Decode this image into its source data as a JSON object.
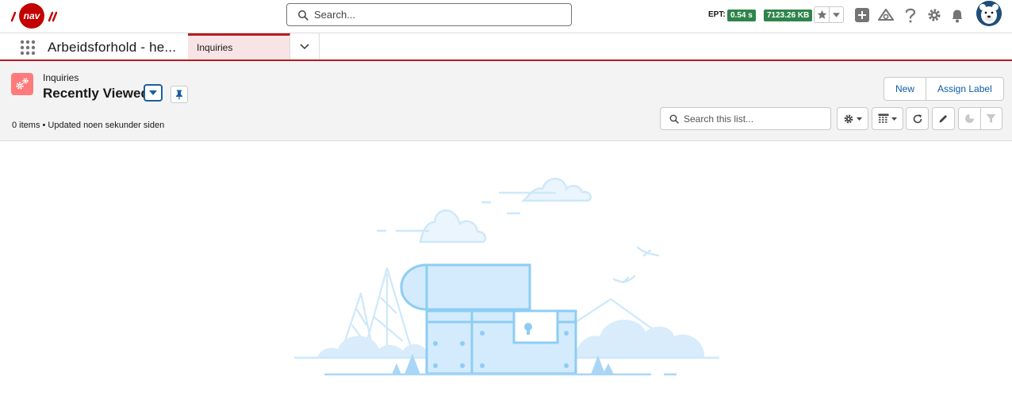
{
  "global_header": {
    "search_placeholder": "Search...",
    "ept_label": "EPT:",
    "ept_value": "0.54 s",
    "memory_value": "7123.26 KB",
    "logo_text": "nav"
  },
  "nav": {
    "app_name": "Arbeidsforhold - he...",
    "tab_label": "Inquiries"
  },
  "list_view": {
    "object_label": "Inquiries",
    "title": "Recently Viewed",
    "meta": "0 items • Updated noen sekunder siden",
    "new_button": "New",
    "assign_label_button": "Assign Label",
    "search_placeholder": "Search this list..."
  },
  "colors": {
    "brand_red": "#c30000",
    "accent_blue": "#0b5cab",
    "success_green": "#2e844a",
    "object_icon": "#ff7a7a"
  },
  "icons": [
    "search-icon",
    "star-icon",
    "chevron-down-icon",
    "add-icon",
    "trailhead-icon",
    "help-icon",
    "gear-icon",
    "bell-icon",
    "avatar",
    "app-launcher-icon",
    "pin-icon",
    "refresh-icon",
    "edit-icon",
    "chart-icon",
    "filter-icon",
    "table-icon"
  ]
}
